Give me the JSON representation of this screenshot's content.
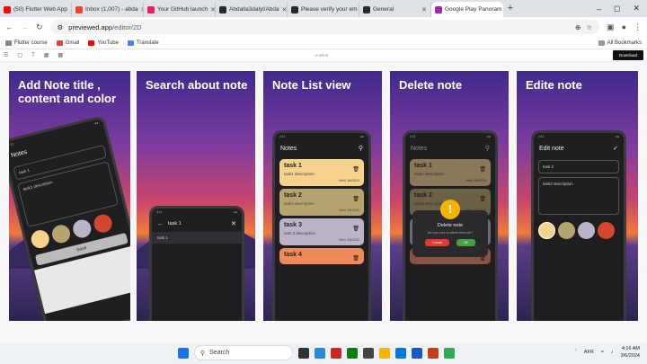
{
  "tabs": [
    {
      "title": "(50) Flutter Web App",
      "icon": "youtube-icon",
      "color": "#ff0000"
    },
    {
      "title": "Inbox (1,007) - abda",
      "icon": "gmail-icon",
      "color": "#ea4335"
    },
    {
      "title": "Your GitHub launch",
      "icon": "pen-icon",
      "color": "#e91e63"
    },
    {
      "title": "Abdalla3dalyl/Abda",
      "icon": "github-icon",
      "color": "#24292e"
    },
    {
      "title": "Please verify your em",
      "icon": "github-icon",
      "color": "#24292e"
    },
    {
      "title": "General",
      "icon": "github-icon",
      "color": "#24292e"
    },
    {
      "title": "Google Play Panoram",
      "icon": "previewed-icon",
      "color": "#9c27b0"
    }
  ],
  "address": {
    "host": "previewed.app",
    "path": "/editor/2D"
  },
  "bookmarks": [
    {
      "label": "Flutter course",
      "color": "#888"
    },
    {
      "label": "Gmail",
      "color": "#ea4335"
    },
    {
      "label": "YouTube",
      "color": "#ff0000"
    },
    {
      "label": "Translate",
      "color": "#4285f4"
    }
  ],
  "all_bookmarks": "All Bookmarks",
  "editor": {
    "title": "Untitled",
    "download": "Download"
  },
  "panels": [
    {
      "heading": "Add Note title , content and color"
    },
    {
      "heading": "Search about note"
    },
    {
      "heading": "Note List view"
    },
    {
      "heading": "Delete note"
    },
    {
      "heading": "Edite note"
    }
  ],
  "p1": {
    "app_title": "Notes",
    "title_value": "task 1",
    "content_value": "task1 description",
    "save": "Save",
    "colors": [
      "#f6d28d",
      "#b5a46d",
      "#bcb3c9",
      "#d4472f"
    ]
  },
  "p2": {
    "query": "task 1",
    "result": "task 1"
  },
  "p3": {
    "app_title": "Notes",
    "notes": [
      {
        "title": "task 1",
        "desc": "task1 description",
        "date": "Wed, 3/6/2024",
        "color": "#f6d28d"
      },
      {
        "title": "task 2",
        "desc": "task2 description",
        "date": "Wed, 3/6/2024",
        "color": "#b5a46d"
      },
      {
        "title": "task 3",
        "desc": "task 3 description",
        "date": "Wed, 3/6/2024",
        "color": "#bcb3c9"
      },
      {
        "title": "task 4",
        "desc": "",
        "date": "",
        "color": "#f08a5d"
      }
    ]
  },
  "p4": {
    "app_title": "Notes",
    "dialog_title": "Delete note",
    "dialog_text": "Are you sure to delete this note?",
    "cancel": "Cancel",
    "ok": "Ok"
  },
  "p5": {
    "app_title": "Edit note",
    "title_value": "task 2",
    "content_value": "task2 description",
    "colors": [
      "#f6d28d",
      "#b5a46d",
      "#bcb3c9",
      "#d4472f"
    ]
  },
  "taskbar": {
    "search": "Search",
    "lang": "AFR",
    "time": "4:16 AM",
    "date": "3/6/2024"
  }
}
